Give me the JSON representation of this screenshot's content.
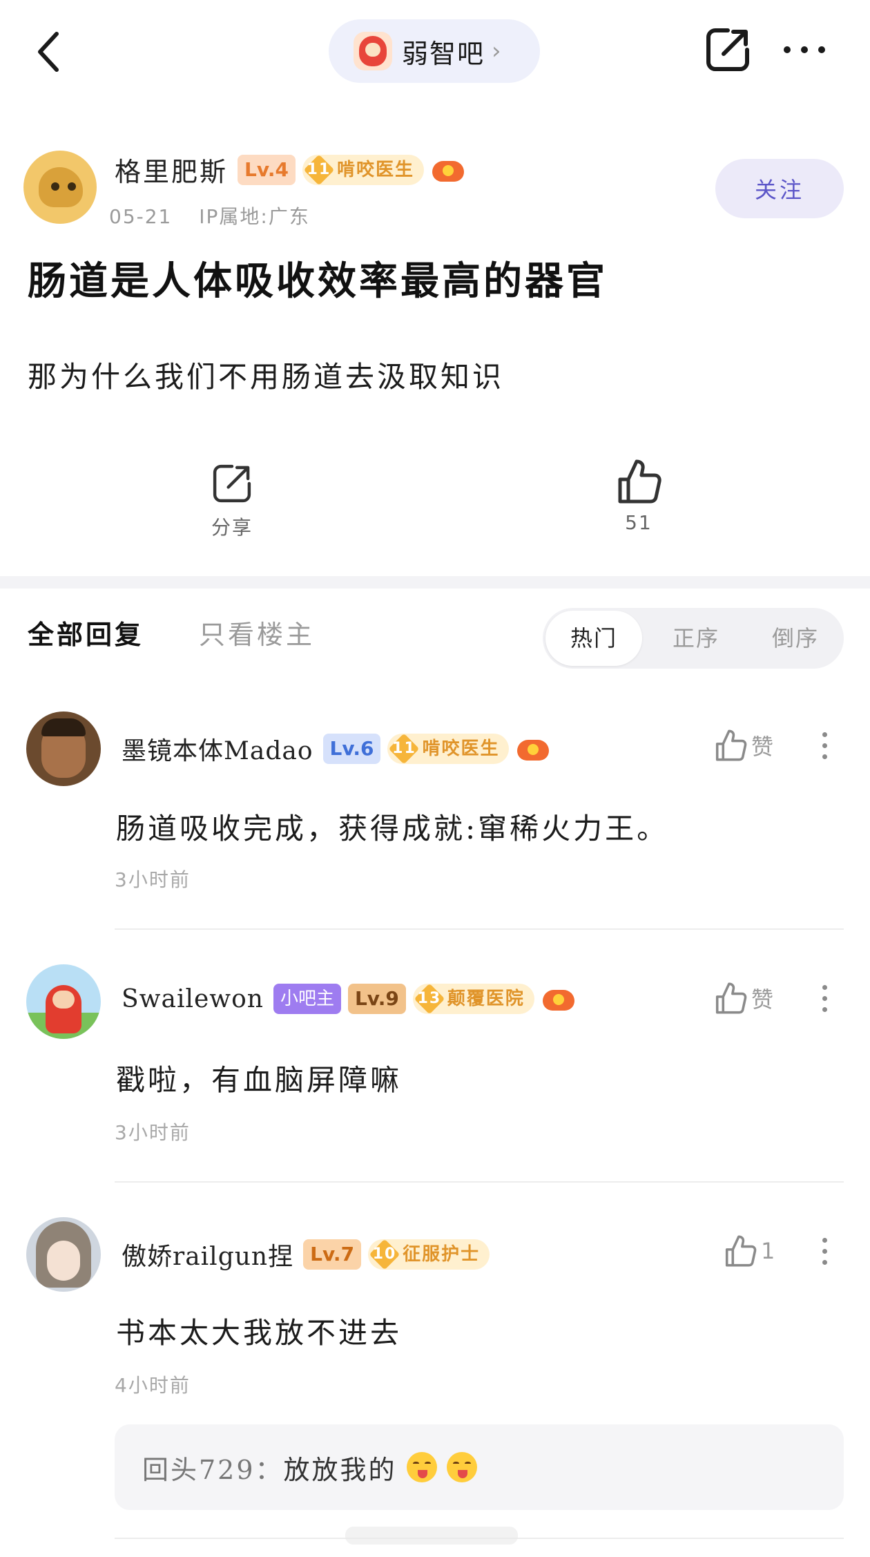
{
  "header": {
    "forum_name": "弱智吧",
    "chevron": "›"
  },
  "post": {
    "author": "格里肥斯",
    "level": "Lv.4",
    "honor_level": "11",
    "honor_title": "啃咬医生",
    "date": "05-21",
    "ip_location": "IP属地:广东",
    "follow_label": "关注",
    "title": "肠道是人体吸收效率最高的器官",
    "body": "那为什么我们不用肠道去汲取知识",
    "share_label": "分享",
    "like_count": "51"
  },
  "replies_header": {
    "all_label": "全部回复",
    "op_only_label": "只看楼主",
    "sort_options": [
      "热门",
      "正序",
      "倒序"
    ],
    "active_sort": "热门"
  },
  "replies": [
    {
      "author": "墨镜本体Madao",
      "level": "Lv.6",
      "honor_level": "11",
      "honor_title": "啃咬医生",
      "text": "肠道吸收完成，获得成就:窜稀火力王。",
      "time": "3小时前",
      "like_label": "赞"
    },
    {
      "author": "Swailewon",
      "role": "小吧主",
      "level": "Lv.9",
      "honor_level": "13",
      "honor_title": "颠覆医院",
      "text": "戳啦，有血脑屏障嘛",
      "time": "3小时前",
      "like_label": "赞"
    },
    {
      "author": "傲娇railgun捏",
      "level": "Lv.7",
      "honor_level": "10",
      "honor_title": "征服护士",
      "text": "书本太大我放不进去",
      "time": "4小时前",
      "like_label": "1",
      "sub_reply": {
        "who": "回头729：",
        "text": "放放我的"
      }
    }
  ],
  "colors": {
    "accent": "#5b55c8",
    "follow_bg": "#eceaf9",
    "honor_bg": "#fff0cf",
    "honor_text": "#e0942a"
  }
}
